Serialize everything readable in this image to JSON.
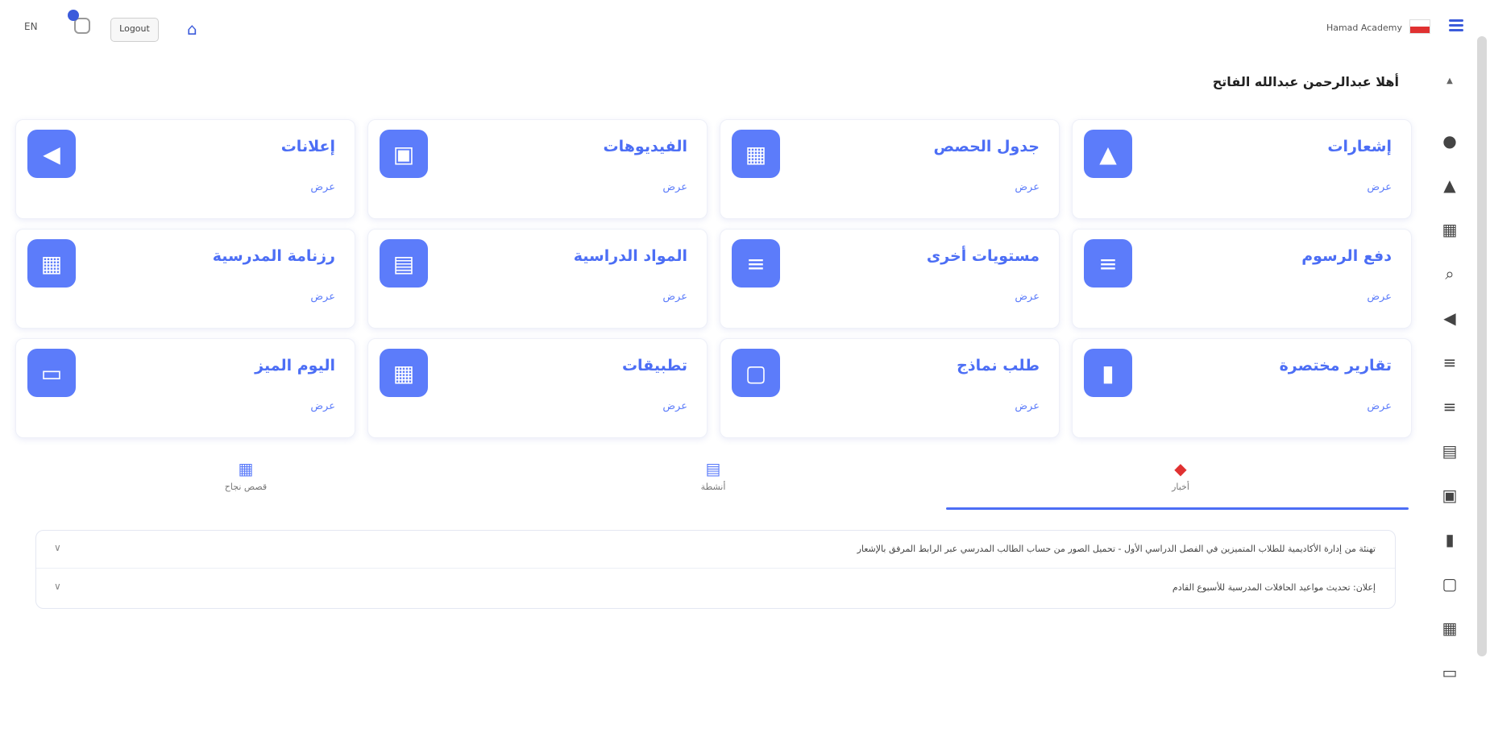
{
  "header": {
    "language": "EN",
    "logout_label": "Logout",
    "school_name": "Hamad Academy",
    "colors": {
      "accent": "#4c6ef5",
      "icon_bg": "#5c7cfa"
    }
  },
  "greeting": "أهلا عبدالرحمن عبدالله الفاتح",
  "cards": [
    {
      "title": "إشعارات",
      "action": "عرض",
      "icon": "bell-icon"
    },
    {
      "title": "جدول الحصص",
      "action": "عرض",
      "icon": "calendar-icon"
    },
    {
      "title": "الفيديوهات",
      "action": "عرض",
      "icon": "video-icon"
    },
    {
      "title": "إعلانات",
      "action": "عرض",
      "icon": "megaphone-icon"
    },
    {
      "title": "دفع الرسوم",
      "action": "عرض",
      "icon": "payment-icon"
    },
    {
      "title": "مستويات أخرى",
      "action": "عرض",
      "icon": "levels-icon"
    },
    {
      "title": "المواد الدراسية",
      "action": "عرض",
      "icon": "book-icon"
    },
    {
      "title": "رزنامة المدرسية",
      "action": "عرض",
      "icon": "calendar-grid-icon"
    },
    {
      "title": "تقارير مختصرة",
      "action": "عرض",
      "icon": "document-icon"
    },
    {
      "title": "طلب نماذج",
      "action": "عرض",
      "icon": "form-icon"
    },
    {
      "title": "تطبيقات",
      "action": "عرض",
      "icon": "apps-icon"
    },
    {
      "title": "اليوم الميز",
      "action": "عرض",
      "icon": "star-icon"
    }
  ],
  "tabs": [
    {
      "label": "أخبار",
      "icon": "news-icon",
      "active": true
    },
    {
      "label": "أنشطة",
      "icon": "activity-icon",
      "active": false
    },
    {
      "label": "قصص نجاح",
      "icon": "success-icon",
      "active": false
    }
  ],
  "news": [
    {
      "text": "تهنئة من إدارة الأكاديمية للطلاب المتميزين في الفصل الدراسي الأول - تحميل الصور من حساب الطالب المدرسي عبر الرابط المرفق بالإشعار"
    },
    {
      "text": "إعلان: تحديث مواعيد الحافلات المدرسية للأسبوع القادم"
    }
  ]
}
